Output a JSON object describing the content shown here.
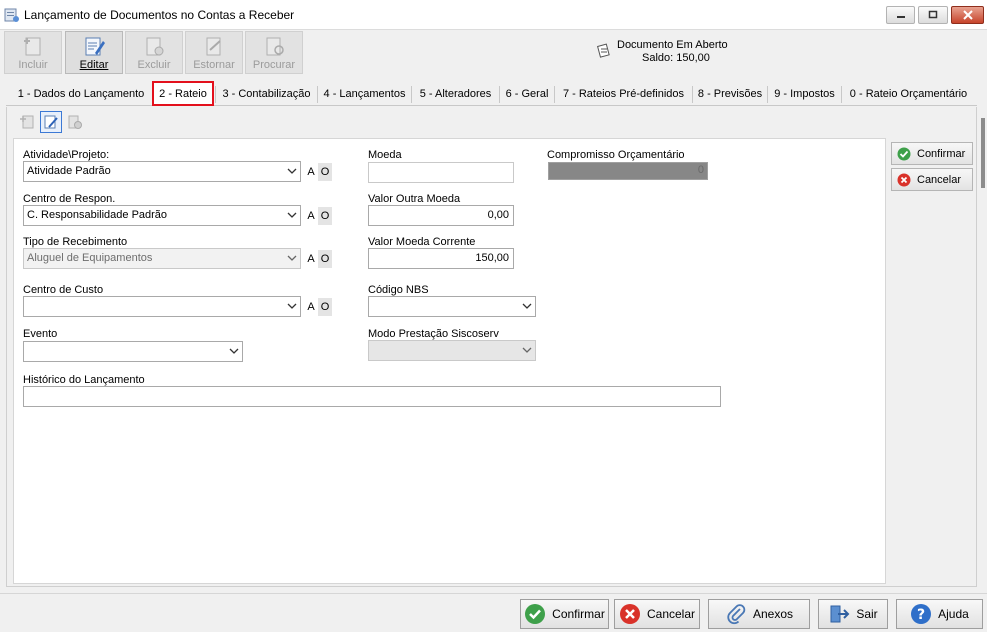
{
  "window": {
    "title": "Lançamento de Documentos no Contas a Receber"
  },
  "toolbar": {
    "incluir": "Incluir",
    "editar": "Editar",
    "excluir": "Excluir",
    "estornar": "Estornar",
    "procurar": "Procurar"
  },
  "document_status": {
    "line1": "Documento Em Aberto",
    "line2": "Saldo: 150,00"
  },
  "tabs": [
    "1 - Dados do Lançamento",
    "2 - Rateio",
    "3 - Contabilização",
    "4 - Lançamentos",
    "5 - Alteradores",
    "6 - Geral",
    "7 - Rateios Pré-definidos",
    "8 - Previsões",
    "9 - Impostos",
    "0 - Rateio Orçamentário"
  ],
  "form": {
    "atividade": {
      "label": "Atividade\\Projeto:",
      "value": "Atividade Padrão"
    },
    "centro_respon": {
      "label": "Centro de Respon.",
      "value": "C. Responsabilidade Padrão"
    },
    "tipo_recebimento": {
      "label": "Tipo de Recebimento",
      "value": "Aluguel de Equipamentos"
    },
    "centro_custo": {
      "label": "Centro de Custo",
      "value": ""
    },
    "evento": {
      "label": "Evento",
      "value": ""
    },
    "historico": {
      "label": "Histórico do Lançamento",
      "value": ""
    },
    "moeda": {
      "label": "Moeda",
      "value": ""
    },
    "valor_outra_moeda": {
      "label": "Valor Outra Moeda",
      "value": "0,00"
    },
    "valor_moeda_corrente": {
      "label": "Valor Moeda Corrente",
      "value": "150,00"
    },
    "codigo_nbs": {
      "label": "Código NBS",
      "value": ""
    },
    "modo_prestacao": {
      "label": "Modo Prestação Siscoserv",
      "value": ""
    },
    "compromisso": {
      "label": "Compromisso Orçamentário",
      "value": "0"
    },
    "a_label": "A",
    "o_label": "O"
  },
  "side": {
    "confirmar": "Confirmar",
    "cancelar": "Cancelar"
  },
  "bottom": {
    "confirmar": "Confirmar",
    "cancelar": "Cancelar",
    "anexos": "Anexos",
    "sair": "Sair",
    "ajuda": "Ajuda"
  },
  "colors": {
    "active_tab_border": "#e3101c",
    "confirm_green": "#3ea04a",
    "cancel_red": "#d9322a",
    "help_blue": "#2f6fc9"
  }
}
